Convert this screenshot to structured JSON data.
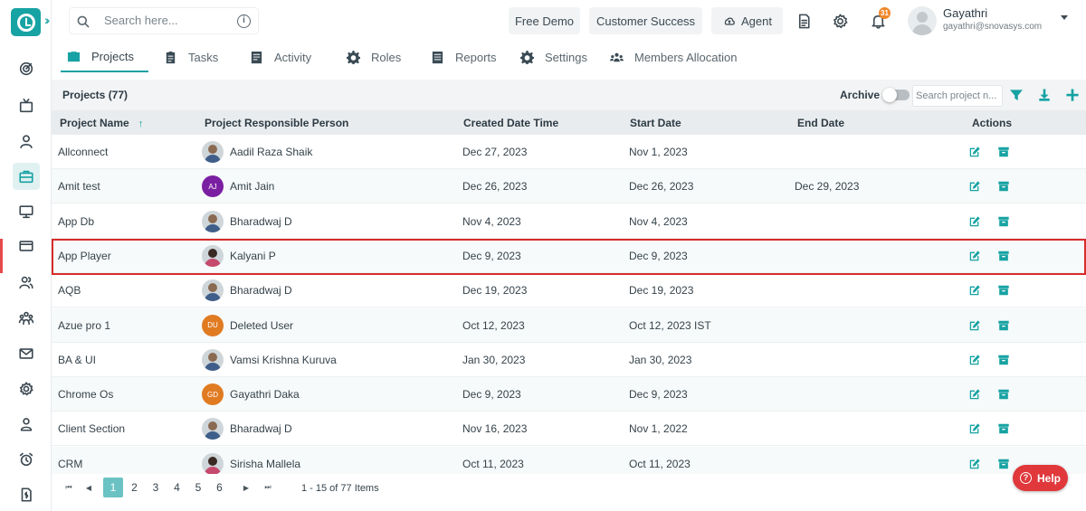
{
  "header": {
    "search_placeholder": "Search here...",
    "buttons": {
      "free_demo": "Free Demo",
      "customer_success": "Customer Success",
      "agent": "Agent"
    },
    "notification_count": "31",
    "user": {
      "name": "Gayathri",
      "email": "gayathri@snovasys.com"
    }
  },
  "tabs": [
    {
      "label": "Projects",
      "icon": "briefcase-icon",
      "active": true
    },
    {
      "label": "Tasks",
      "icon": "clipboard-icon"
    },
    {
      "label": "Activity",
      "icon": "activity-icon"
    },
    {
      "label": "Roles",
      "icon": "gear-icon"
    },
    {
      "label": "Reports",
      "icon": "report-icon"
    },
    {
      "label": "Settings",
      "icon": "settings-icon"
    },
    {
      "label": "Members Allocation",
      "icon": "members-icon"
    }
  ],
  "panel": {
    "title": "Projects (77)",
    "archive_label": "Archive",
    "search_placeholder": "Search project n..."
  },
  "columns": {
    "name": "Project Name",
    "person": "Project Responsible Person",
    "created": "Created Date Time",
    "start": "Start Date",
    "end": "End Date",
    "actions": "Actions"
  },
  "rows": [
    {
      "name": "Allconnect",
      "person": "Aadil Raza Shaik",
      "created": "Dec 27, 2023",
      "start": "Nov 1, 2023",
      "end": ""
    },
    {
      "name": "Amit test",
      "person": "Amit Jain",
      "initials": "AJ",
      "avatar_color": "#7b1fa2",
      "created": "Dec 26, 2023",
      "start": "Dec 26, 2023",
      "end": "Dec 29, 2023"
    },
    {
      "name": "App Db",
      "person": "Bharadwaj D",
      "created": "Nov 4, 2023",
      "start": "Nov 4, 2023",
      "end": ""
    },
    {
      "name": "App Player",
      "person": "Kalyani P",
      "created": "Dec 9, 2023",
      "start": "Dec 9, 2023",
      "end": ""
    },
    {
      "name": "AQB",
      "person": "Bharadwaj D",
      "created": "Dec 19, 2023",
      "start": "Dec 19, 2023",
      "end": ""
    },
    {
      "name": "Azue pro 1",
      "person": "Deleted User",
      "initials": "DU",
      "avatar_color": "#e07b22",
      "created": "Oct 12, 2023",
      "start": "Oct 12, 2023 IST",
      "end": ""
    },
    {
      "name": "BA & UI",
      "person": "Vamsi Krishna Kuruva",
      "created": "Jan 30, 2023",
      "start": "Jan 30, 2023",
      "end": ""
    },
    {
      "name": "Chrome Os",
      "person": "Gayathri Daka",
      "initials": "GD",
      "avatar_color": "#e07b22",
      "created": "Dec 9, 2023",
      "start": "Dec 9, 2023",
      "end": ""
    },
    {
      "name": "Client Section",
      "person": "Bharadwaj D",
      "created": "Nov 16, 2023",
      "start": "Nov 1, 2022",
      "end": ""
    },
    {
      "name": "CRM",
      "person": "Sirisha Mallela",
      "created": "Oct 11, 2023",
      "start": "Oct 11, 2023",
      "end": ""
    }
  ],
  "pagination": {
    "pages": [
      "1",
      "2",
      "3",
      "4",
      "5",
      "6"
    ],
    "current": "1",
    "info": "1 - 15 of 77 Items"
  },
  "help_label": "Help",
  "colors": {
    "accent": "#17a2a3",
    "highlight": "#d92b2b",
    "help": "#e0383b"
  }
}
